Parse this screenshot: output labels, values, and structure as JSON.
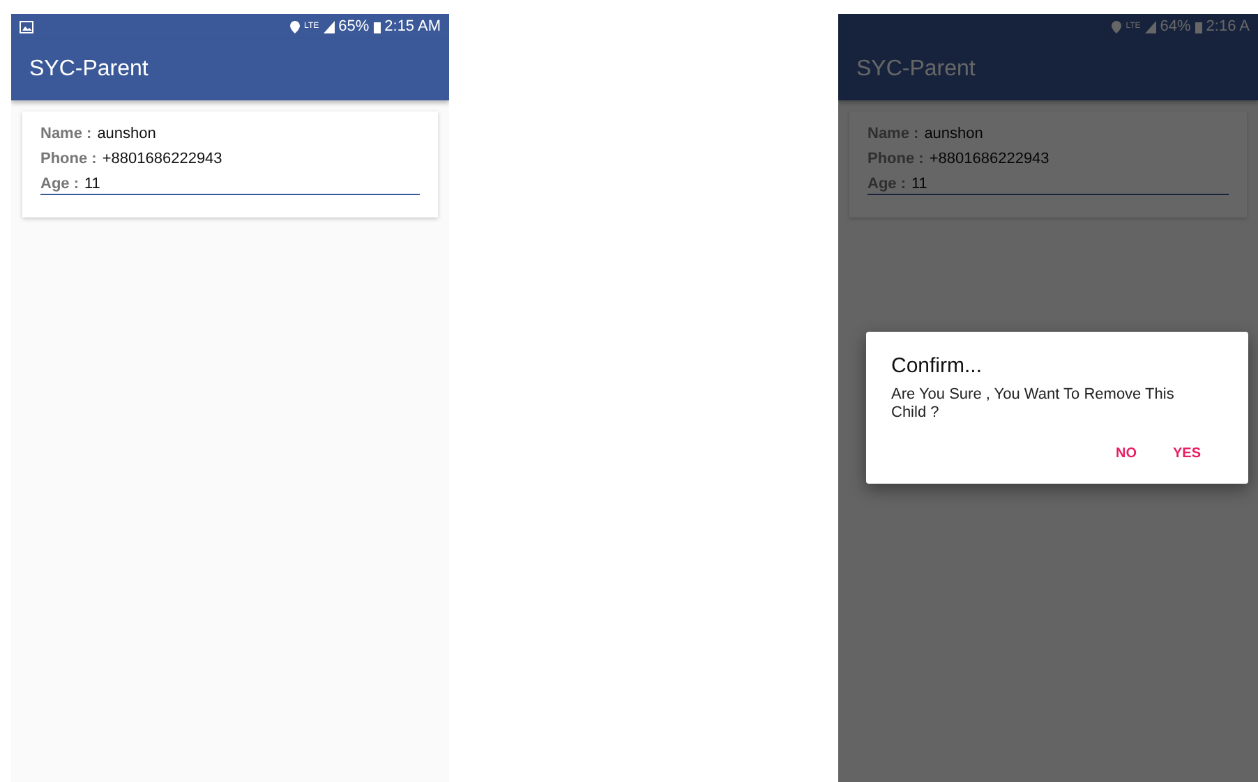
{
  "screens": [
    {
      "status": {
        "notification": true,
        "network": "LTE",
        "battery": "65%",
        "time": "2:15 AM"
      },
      "app_title": "SYC-Parent",
      "fields": [
        {
          "label": "Name :",
          "value": "aunshon",
          "kind": "text"
        },
        {
          "label": "Phone :",
          "value": "+8801686222943",
          "kind": "text"
        },
        {
          "label": "Age :",
          "value": "11",
          "kind": "input"
        }
      ]
    },
    {
      "status": {
        "notification": false,
        "network": "LTE",
        "battery": "64%",
        "time": "2:16 A"
      },
      "app_title": "SYC-Parent",
      "fields": [
        {
          "label": "Name :",
          "value": "aunshon",
          "kind": "text"
        },
        {
          "label": "Phone :",
          "value": "+8801686222943",
          "kind": "text"
        },
        {
          "label": "Age :",
          "value": "11",
          "kind": "input"
        }
      ],
      "dialog": {
        "title": "Confirm...",
        "message": "Are You Sure , You Want To Remove This Child ?",
        "buttons": [
          "NO",
          "YES"
        ]
      }
    }
  ]
}
